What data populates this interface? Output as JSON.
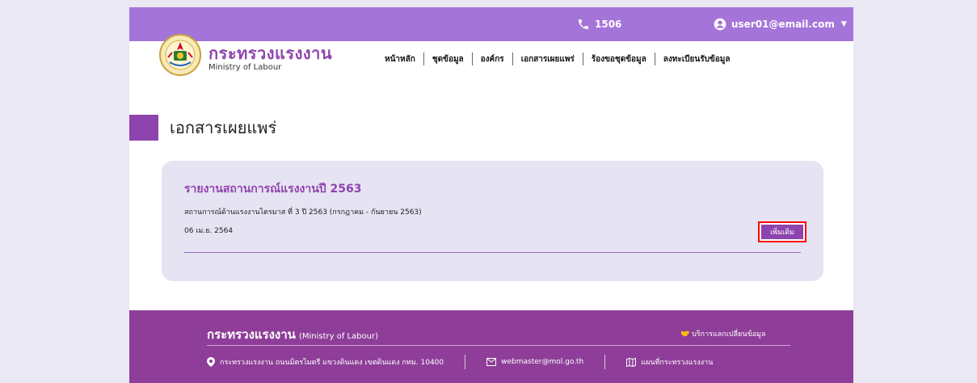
{
  "topbar": {
    "phone": "1506",
    "user": "user01@email.com"
  },
  "brand": {
    "name_th": "กระทรวงแรงงาน",
    "name_en": "Ministry of Labour"
  },
  "nav": {
    "items": [
      "หน้าหลัก",
      "ชุดข้อมูล",
      "องค์กร",
      "เอกสารเผยแพร่",
      "ร้องขอชุดข้อมูล",
      "ลงทะเบียนรับข้อมูล"
    ]
  },
  "page": {
    "title": "เอกสารเผยแพร่"
  },
  "card": {
    "title": "รายงานสถานการณ์แรงงานปี 2563",
    "description": "สถานการณ์ด้านแรงงานไตรมาส ที่ 3 ปี 2563 (กรกฎาคม - กันยายน 2563)",
    "date": "06 เม.ย. 2564",
    "button": "เพิ่มเติม"
  },
  "footer": {
    "brand": "กระทรวงแรงงาน",
    "brand_en": "(Ministry of Labour)",
    "service": "บริการแลกเปลี่ยนข้อมูล",
    "address": "กระทรวงแรงงาน ถนนมิตรไมตรี แขวงดินแดง เขตดินแดง กทม. 10400",
    "email": "webmaster@mol.go.th",
    "map": "แผนที่กระทรวงแรงงาน"
  },
  "colors": {
    "primary": "#8e44ad",
    "topbar": "#a574d9",
    "footer": "#8e3e98",
    "card": "#e6e3f2",
    "highlight": "#ff0000"
  },
  "icons": [
    "phone-icon",
    "user-circle-icon",
    "chevron-down-icon",
    "ministry-seal-logo",
    "map-pin-icon",
    "envelope-icon",
    "map-icon",
    "handshake-icon"
  ]
}
